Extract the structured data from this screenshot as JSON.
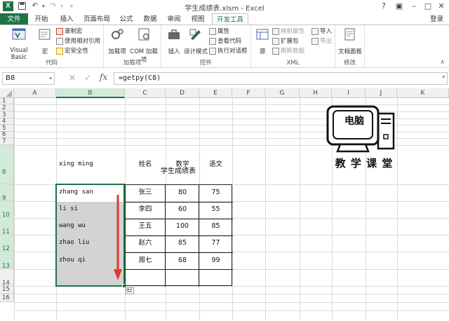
{
  "titlebar": {
    "app_icon": "X",
    "title": "学生成绩表.xlsm - Excel"
  },
  "tabs": [
    "文件",
    "开始",
    "插入",
    "页面布局",
    "公式",
    "数据",
    "审阅",
    "视图",
    "开发工具"
  ],
  "signin": "登录",
  "ribbon": {
    "code": {
      "label": "代码",
      "visual_basic": "Visual Basic",
      "macro": "宏",
      "record": "录制宏",
      "relative": "使用相对引用",
      "security": "宏安全性"
    },
    "addins": {
      "label": "加载项",
      "addins": "加载项",
      "com": "COM 加载项"
    },
    "controls": {
      "label": "控件",
      "insert": "插入",
      "design": "设计模式",
      "properties": "属性",
      "view_code": "查看代码",
      "run_dialog": "执行对话框"
    },
    "xml": {
      "label": "XML",
      "source": "源",
      "map_props": "映射属性",
      "ext_pack": "扩展包",
      "refresh": "刷新数据",
      "import": "导入",
      "export": "导出"
    },
    "modify": {
      "label": "修改",
      "doc_panel": "文档面板"
    }
  },
  "formula_bar": {
    "name_box": "B8",
    "formula": "=getpy(C8)"
  },
  "columns": [
    "A",
    "B",
    "C",
    "D",
    "E",
    "F",
    "G",
    "H",
    "I",
    "J",
    "K"
  ],
  "rows": [
    "1",
    "2",
    "3",
    "4",
    "5",
    "6",
    "7",
    "8",
    "9",
    "10",
    "11",
    "12",
    "13",
    "14",
    "15",
    "16"
  ],
  "sheet": {
    "title": "学生成绩表",
    "b_values": [
      "xing ming",
      "zhang san",
      "li si",
      "wang wu",
      "zhao liu",
      "zhou qi"
    ],
    "headers": [
      "姓名",
      "数学",
      "语文"
    ],
    "table": [
      [
        "张三",
        "80",
        "75"
      ],
      [
        "李四",
        "60",
        "55"
      ],
      [
        "王五",
        "100",
        "85"
      ],
      [
        "赵六",
        "85",
        "77"
      ],
      [
        "周七",
        "68",
        "99"
      ]
    ]
  },
  "logo": {
    "screen_text": "电脑",
    "caption": "教 学 课 堂"
  },
  "colors": {
    "excel_green": "#217346",
    "selection": "#d3d3d3",
    "arrow": "#e03a2c"
  }
}
